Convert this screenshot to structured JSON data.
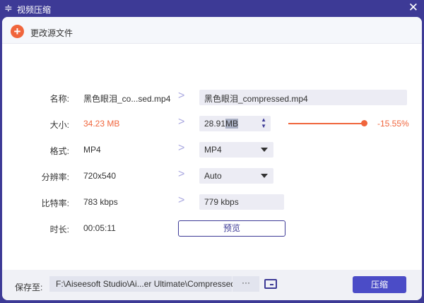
{
  "title": "视频压缩",
  "header": {
    "add_label": "更改源文件"
  },
  "rows": {
    "name": {
      "label": "名称:",
      "source": "黑色眼泪_co...sed.mp4",
      "output": "黑色眼泪_compressed.mp4"
    },
    "size": {
      "label": "大小:",
      "source": "34.23 MB",
      "output_num": "28.91",
      "output_unit": "MB",
      "percent": "-15.55%",
      "slider_level": 0.96
    },
    "format": {
      "label": "格式:",
      "source": "MP4",
      "output": "MP4"
    },
    "resolution": {
      "label": "分辨率:",
      "source": "720x540",
      "output": "Auto"
    },
    "bitrate": {
      "label": "比特率:",
      "source": "783 kbps",
      "output": "779 kbps"
    },
    "duration": {
      "label": "时长:",
      "source": "00:05:11",
      "preview": "预览"
    }
  },
  "footer": {
    "save_label": "保存至:",
    "path": "F:\\Aiseesoft Studio\\Ai...er Ultimate\\Compressed",
    "more": "···",
    "compress": "压缩"
  },
  "colors": {
    "accent": "#3d3a96",
    "orange": "#f0653c"
  }
}
